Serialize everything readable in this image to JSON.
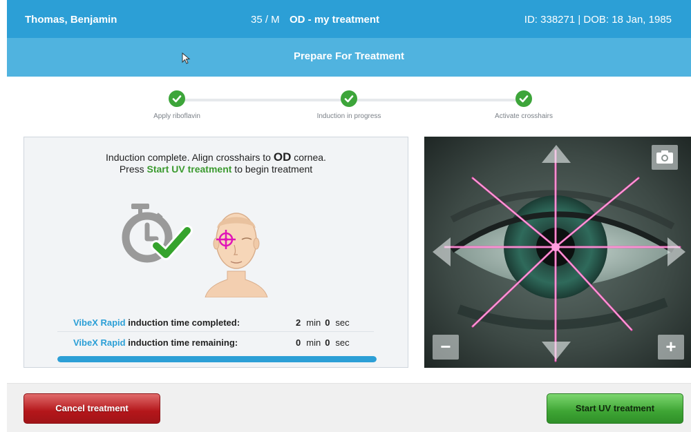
{
  "patient": {
    "name": "Thomas, Benjamin",
    "age_sex": "35 / M",
    "eye_plan": "OD - my treatment",
    "id_dob": "ID: 338271 | DOB: 18 Jan, 1985"
  },
  "title": "Prepare For Treatment",
  "steps": [
    {
      "label": "Apply riboflavin",
      "status": "done"
    },
    {
      "label": "Induction in progress",
      "status": "done"
    },
    {
      "label": "Activate crosshairs",
      "status": "done"
    }
  ],
  "instructions": {
    "line1_pre": "Induction complete. Align crosshairs to ",
    "line1_eye": "OD",
    "line1_post": " cornea.",
    "line2_pre": "Press ",
    "line2_action": "Start UV treatment",
    "line2_post": " to begin treatment"
  },
  "timers": {
    "completed": {
      "brand": "VibeX Rapid",
      "label": " induction time completed:",
      "min": "2",
      "sec": "0"
    },
    "remaining": {
      "brand": "VibeX Rapid",
      "label": " induction time remaining:",
      "min": "0",
      "sec": "0"
    },
    "min_unit": "min",
    "sec_unit": "sec"
  },
  "progress": 1.0,
  "camera": {
    "zoom_out_label": "−",
    "zoom_in_label": "+"
  },
  "footer": {
    "cancel_label": "Cancel treatment",
    "start_label": "Start UV treatment"
  },
  "colors": {
    "header": "#2c9fd6",
    "title_bar": "#50b3df",
    "success": "#3da53a",
    "cancel": "#b4161a",
    "start": "#3ea534",
    "laser": "#ff4fb8"
  }
}
